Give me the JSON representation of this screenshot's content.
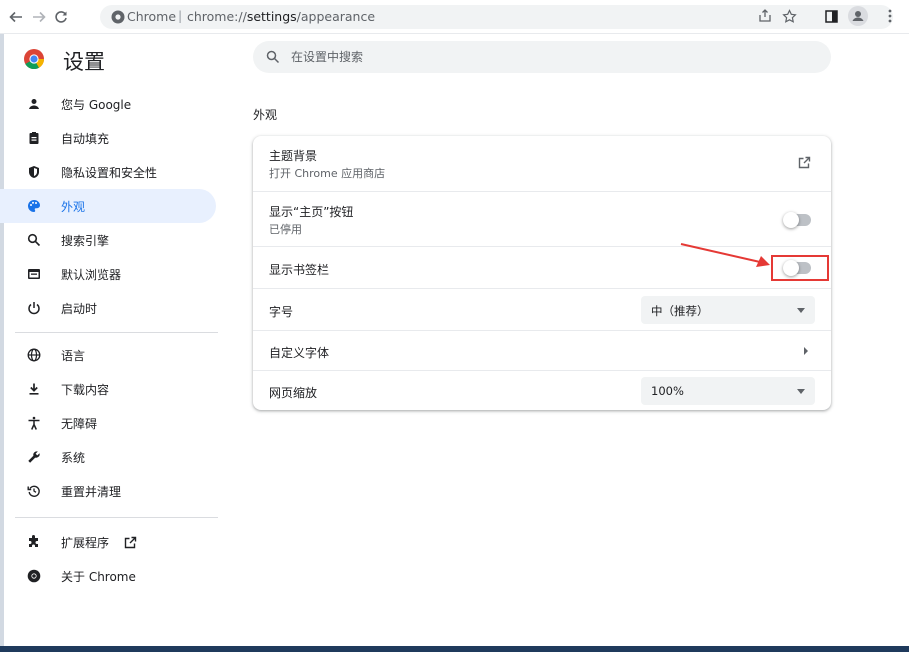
{
  "browser": {
    "site_name": "Chrome",
    "url_scheme": "chrome://",
    "url_path": "settings",
    "url_rest": "/appearance"
  },
  "brand": {
    "title": "设置"
  },
  "search": {
    "placeholder": "在设置中搜索"
  },
  "sidebar": {
    "items": [
      {
        "label": "您与 Google",
        "icon": "person-icon"
      },
      {
        "label": "自动填充",
        "icon": "clipboard-icon"
      },
      {
        "label": "隐私设置和安全性",
        "icon": "shield-icon"
      },
      {
        "label": "外观",
        "icon": "palette-icon",
        "active": true
      },
      {
        "label": "搜索引擎",
        "icon": "search-icon"
      },
      {
        "label": "默认浏览器",
        "icon": "browser-icon"
      },
      {
        "label": "启动时",
        "icon": "power-icon"
      },
      {
        "label": "语言",
        "icon": "globe-icon"
      },
      {
        "label": "下载内容",
        "icon": "download-icon"
      },
      {
        "label": "无障碍",
        "icon": "accessibility-icon"
      },
      {
        "label": "系统",
        "icon": "wrench-icon"
      },
      {
        "label": "重置并清理",
        "icon": "reset-icon"
      },
      {
        "label": "扩展程序",
        "icon": "puzzle-icon"
      },
      {
        "label": "关于 Chrome",
        "icon": "chrome-icon"
      }
    ]
  },
  "main": {
    "section_title": "外观",
    "rows": {
      "theme": {
        "title": "主题背景",
        "subtitle": "打开 Chrome 应用商店"
      },
      "home_button": {
        "title": "显示“主页”按钮",
        "subtitle": "已停用",
        "enabled": false
      },
      "bookmarks_bar": {
        "title": "显示书签栏",
        "enabled": false
      },
      "font_size": {
        "title": "字号",
        "value": "中（推荐）"
      },
      "custom_fonts": {
        "title": "自定义字体"
      },
      "page_zoom": {
        "title": "网页缩放",
        "value": "100%"
      }
    }
  },
  "colors": {
    "accent": "#1a73e8",
    "active_bg": "#e8f0fe",
    "annotation": "#e53935"
  }
}
